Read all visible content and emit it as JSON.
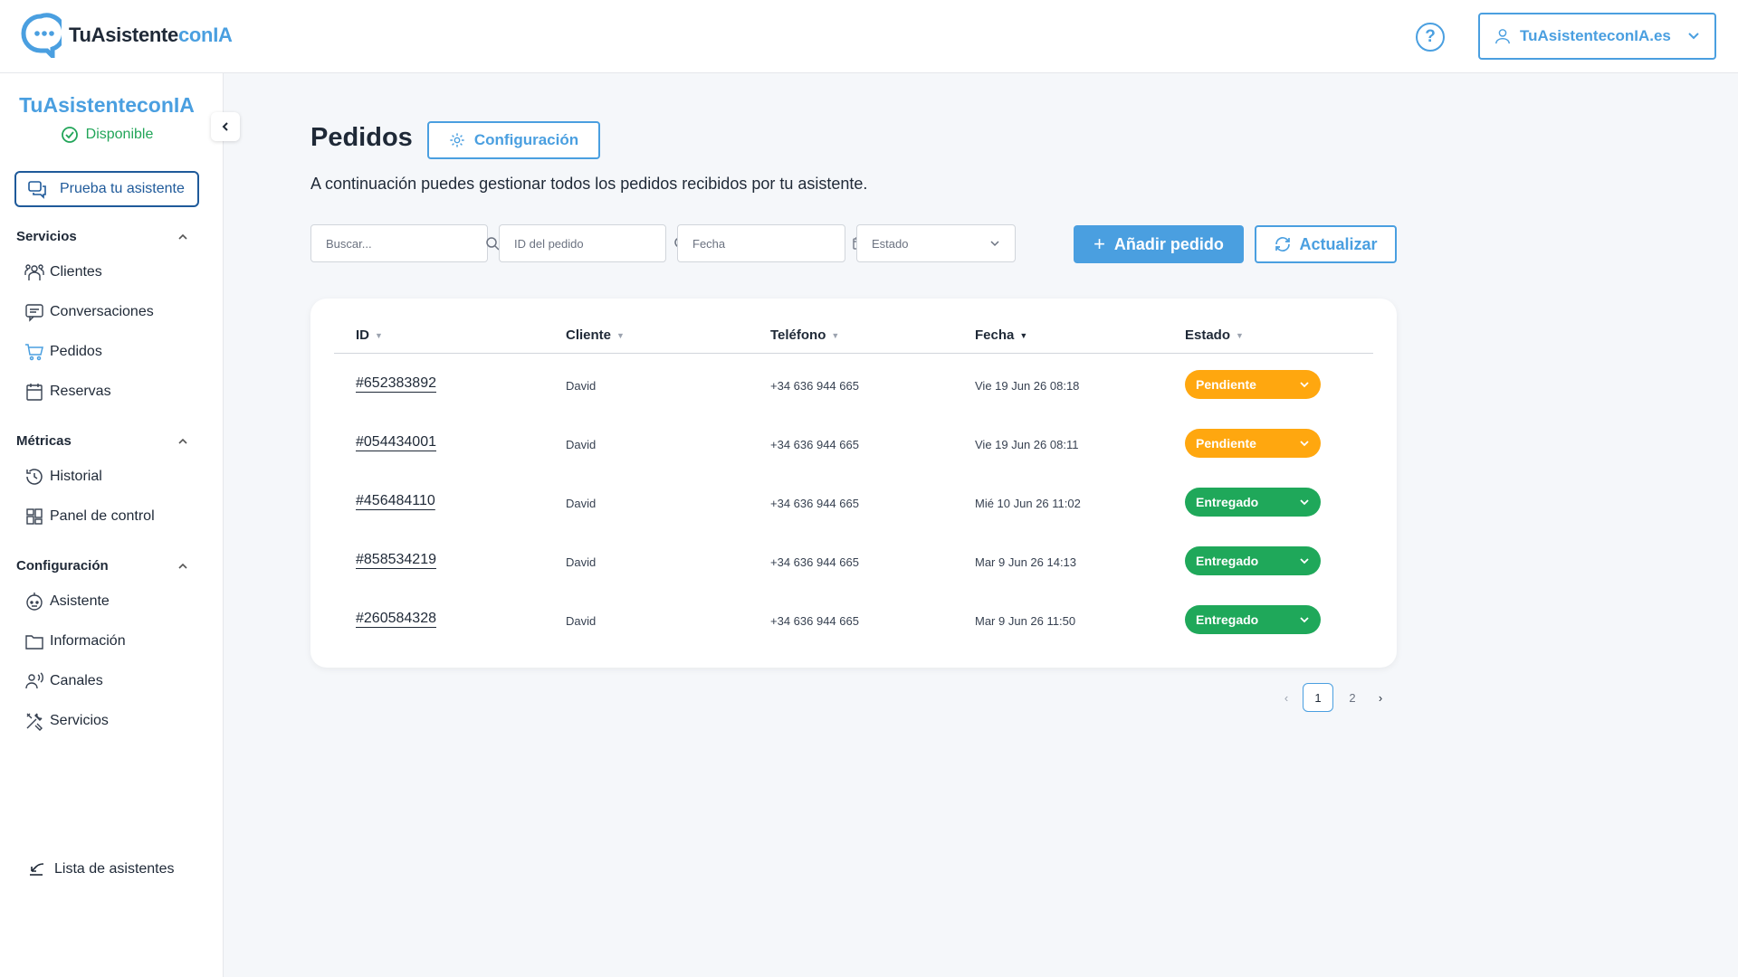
{
  "header": {
    "logo_main": "TuAsistente",
    "logo_accent": "conIA",
    "help_icon": "question-circle-icon",
    "account_label": "TuAsistenteconIA.es"
  },
  "sidebar": {
    "brand": "TuAsistenteconIA",
    "status": "Disponible",
    "status_color": "#22a559",
    "test_button": "Prueba tu asistente",
    "sections": [
      {
        "title": "Servicios",
        "items": [
          {
            "label": "Clientes",
            "icon": "clients-icon"
          },
          {
            "label": "Conversaciones",
            "icon": "chat-icon"
          },
          {
            "label": "Pedidos",
            "icon": "cart-icon"
          },
          {
            "label": "Reservas",
            "icon": "calendar-icon"
          }
        ]
      },
      {
        "title": "Métricas",
        "items": [
          {
            "label": "Historial",
            "icon": "history-icon"
          },
          {
            "label": "Panel de control",
            "icon": "dashboard-icon"
          }
        ]
      },
      {
        "title": "Configuración",
        "items": [
          {
            "label": "Asistente",
            "icon": "bot-icon"
          },
          {
            "label": "Información",
            "icon": "folder-icon"
          },
          {
            "label": "Canales",
            "icon": "channels-icon"
          },
          {
            "label": "Servicios",
            "icon": "tools-icon"
          }
        ]
      }
    ],
    "list_link": "Lista de asistentes"
  },
  "main": {
    "title": "Pedidos",
    "config_button": "Configuración",
    "description": "A continuación puedes gestionar todos los pedidos recibidos por tu asistente.",
    "filters": {
      "search_placeholder": "Buscar...",
      "order_id_placeholder": "ID del pedido",
      "date_placeholder": "Fecha",
      "status_placeholder": "Estado"
    },
    "add_button": "Añadir pedido",
    "refresh_button": "Actualizar",
    "table": {
      "columns": [
        "ID",
        "Cliente",
        "Teléfono",
        "Fecha",
        "Estado"
      ],
      "rows": [
        {
          "id": "#652383892",
          "client": "David",
          "phone": "+34 636 944 665",
          "date": "Vie 19 Jun 26 08:18",
          "status": "Pendiente"
        },
        {
          "id": "#054434001",
          "client": "David",
          "phone": "+34 636 944 665",
          "date": "Vie 19 Jun 26 08:11",
          "status": "Pendiente"
        },
        {
          "id": "#456484110",
          "client": "David",
          "phone": "+34 636 944 665",
          "date": "Mié 10 Jun 26 11:02",
          "status": "Entregado"
        },
        {
          "id": "#858534219",
          "client": "David",
          "phone": "+34 636 944 665",
          "date": "Mar 9 Jun 26 14:13",
          "status": "Entregado"
        },
        {
          "id": "#260584328",
          "client": "David",
          "phone": "+34 636 944 665",
          "date": "Mar 9 Jun 26 11:50",
          "status": "Entregado"
        }
      ],
      "status_colors": {
        "Pendiente": "#ffa70f",
        "Entregado": "#1fa85a"
      }
    },
    "pagination": {
      "pages": [
        "1",
        "2"
      ],
      "current": "1",
      "prev_arrow": "‹",
      "next_arrow": "›"
    }
  },
  "colors": {
    "accent": "#4a9fe0",
    "background": "#f5f7fa"
  }
}
